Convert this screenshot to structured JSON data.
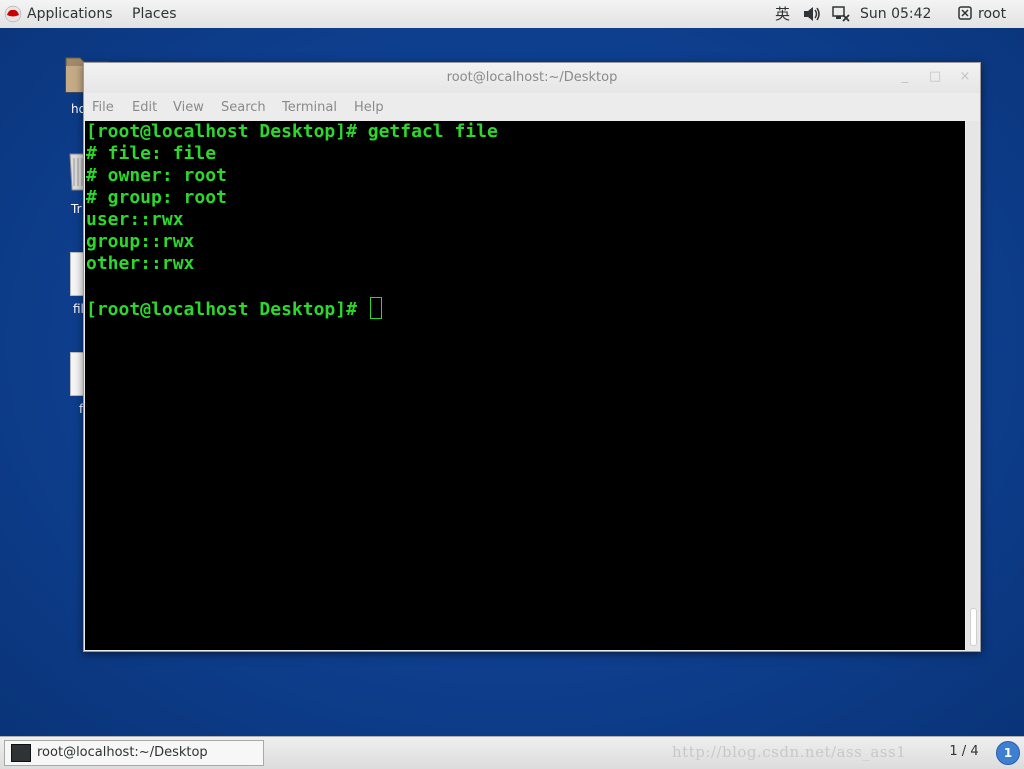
{
  "topbar": {
    "applications": "Applications",
    "places": "Places",
    "ime": "英",
    "clock": "Sun 05:42",
    "user": "root"
  },
  "desktop_icons": [
    {
      "label": "ho",
      "icon": "home-folder-icon"
    },
    {
      "label": "Tr",
      "icon": "trash-icon"
    },
    {
      "label": "fil",
      "icon": "file-icon"
    },
    {
      "label": "f",
      "icon": "file-icon"
    }
  ],
  "terminal": {
    "title": "root@localhost:~/Desktop",
    "menu": [
      "File",
      "Edit",
      "View",
      "Search",
      "Terminal",
      "Help"
    ],
    "lines": [
      "[root@localhost Desktop]# getfacl file",
      "# file: file",
      "# owner: root",
      "# group: root",
      "user::rwx",
      "group::rwx",
      "other::rwx",
      "",
      "[root@localhost Desktop]# "
    ],
    "text_color": "#2bd82b",
    "background": "#000000"
  },
  "taskbar": {
    "window_label": "root@localhost:~/Desktop",
    "watermark": "http://blog.csdn.net/ass_ass1",
    "workspace": "1 / 4",
    "notifications": "1"
  }
}
